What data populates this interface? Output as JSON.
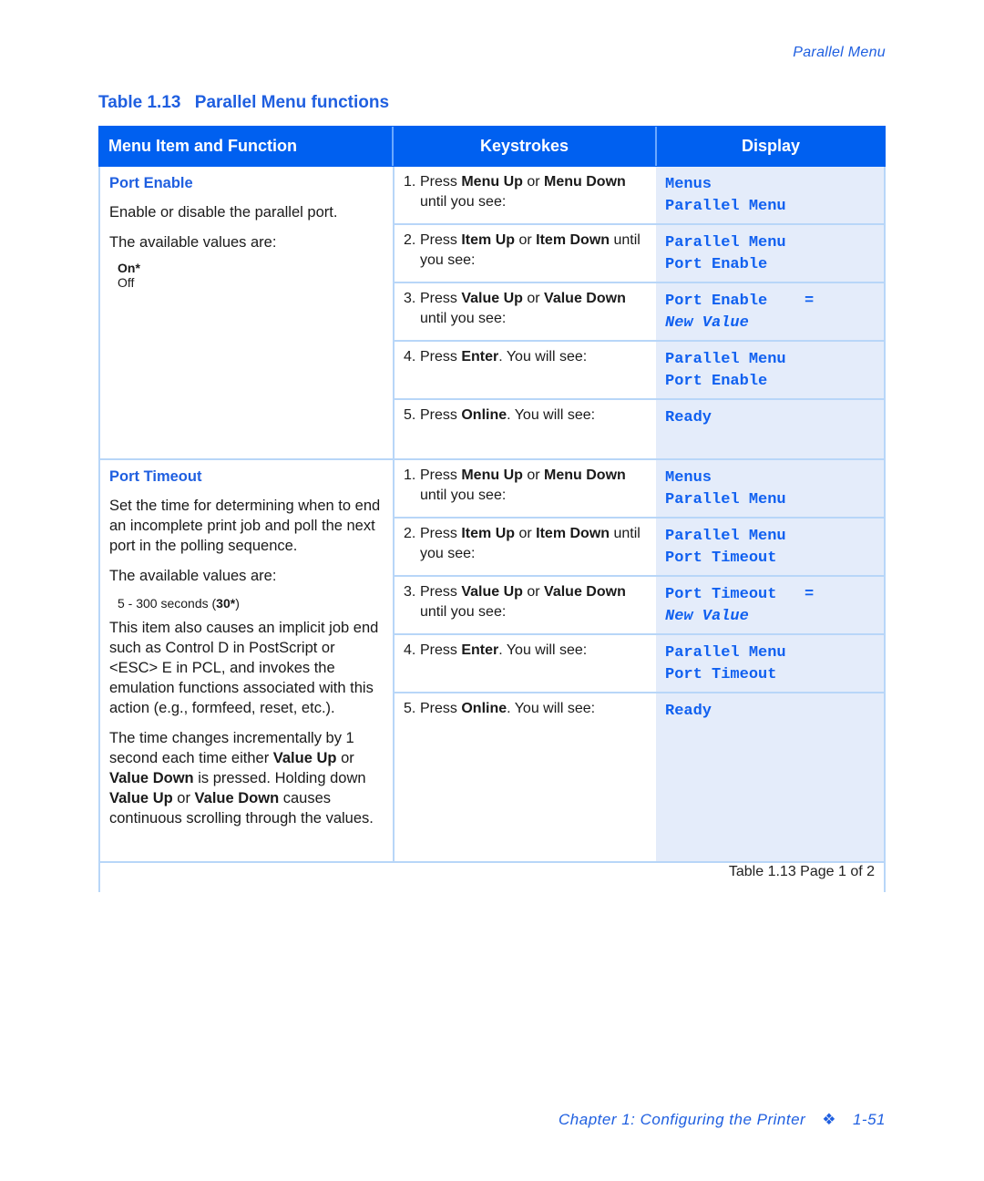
{
  "running_head": "Parallel Menu",
  "caption": {
    "number": "Table 1.13",
    "title": "Parallel Menu functions"
  },
  "headers": [
    "Menu Item and Function",
    "Keystrokes",
    "Display"
  ],
  "sections": [
    {
      "title": "Port Enable",
      "paragraphs_before": [
        "Enable or disable the parallel port.",
        "The available values are:"
      ],
      "values": [
        {
          "text": "On*",
          "default": true
        },
        {
          "text": "Off",
          "default": false
        }
      ],
      "steps": [
        {
          "n": "1.",
          "pre": "Press ",
          "b1": "Menu Up",
          "mid": " or ",
          "b2": "Menu Down",
          "post": " until you see:",
          "display": [
            "Menus",
            "Parallel Menu"
          ]
        },
        {
          "n": "2.",
          "pre": "Press ",
          "b1": "Item Up",
          "mid": " or ",
          "b2": "Item Down",
          "post": " until you see:",
          "display": [
            "Parallel Menu",
            "Port Enable"
          ]
        },
        {
          "n": "3.",
          "pre": "Press ",
          "b1": "Value Up",
          "mid": " or ",
          "b2": "Value Down",
          "post": " until you see:",
          "display": [
            "Port Enable    =",
            "New Value"
          ]
        },
        {
          "n": "4.",
          "pre": "Press ",
          "b1": "Enter",
          "mid": ". You will see:",
          "b2": "",
          "post": "",
          "display": [
            "Parallel Menu",
            "Port Enable"
          ]
        },
        {
          "n": "5.",
          "pre": "Press ",
          "b1": "Online",
          "mid": ". You will see:",
          "b2": "",
          "post": "",
          "display": [
            "Ready",
            ""
          ]
        }
      ]
    },
    {
      "title": "Port Timeout",
      "paragraphs_before": [
        "Set the time for determining when to end an incomplete print job and poll the next port in the polling sequence.",
        "The available values are:"
      ],
      "values_text": {
        "pre": "5 - 300 seconds (",
        "bold": "30*",
        "post": ")"
      },
      "paragraphs_after": [
        "This item also causes an implicit job end such as Control D in PostScript or <ESC> E in PCL, and invokes the emulation functions associated with this action (e.g., formfeed, reset, etc.)."
      ],
      "last_paragraph": {
        "t1": "The time changes incrementally by 1 second each time either ",
        "b1": "Value Up",
        "t2": " or ",
        "b2": "Value Down",
        "t3": " is pressed. Holding down ",
        "b3": "Value Up",
        "t4": " or ",
        "b4": "Value Down",
        "t5": " causes continuous scrolling through the values."
      },
      "steps": [
        {
          "n": "1.",
          "pre": "Press ",
          "b1": "Menu Up",
          "mid": " or ",
          "b2": "Menu Down",
          "post": " until you see:",
          "display": [
            "Menus",
            "Parallel Menu"
          ]
        },
        {
          "n": "2.",
          "pre": "Press ",
          "b1": "Item Up",
          "mid": " or ",
          "b2": "Item Down",
          "post": " until you see:",
          "display": [
            "Parallel Menu",
            "Port Timeout"
          ]
        },
        {
          "n": "3.",
          "pre": "Press ",
          "b1": "Value Up",
          "mid": " or ",
          "b2": "Value Down",
          "post": " until you see:",
          "display": [
            "Port Timeout   =",
            "New Value"
          ]
        },
        {
          "n": "4.",
          "pre": "Press ",
          "b1": "Enter",
          "mid": ". You will see:",
          "b2": "",
          "post": "",
          "display": [
            "Parallel Menu",
            "Port Timeout"
          ]
        },
        {
          "n": "5.",
          "pre": "Press ",
          "b1": "Online",
          "mid": ". You will see:",
          "b2": "",
          "post": "",
          "display": [
            "Ready",
            ""
          ]
        }
      ]
    }
  ],
  "table_footer": "Table 1.13  Page 1 of 2",
  "page_footer": {
    "chapter": "Chapter 1: Configuring the Printer",
    "ornament": "❖",
    "page": "1-51"
  }
}
